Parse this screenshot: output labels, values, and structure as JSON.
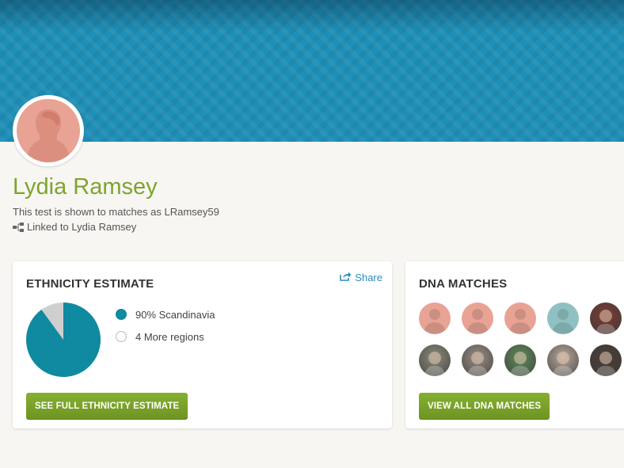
{
  "profile": {
    "name": "Lydia Ramsey",
    "shown_as": "This test is shown to matches as LRamsey59",
    "linked_to": "Linked to Lydia Ramsey"
  },
  "ethnicity": {
    "title": "ETHNICITY ESTIMATE",
    "share_label": "Share",
    "regions": [
      {
        "label": "90% Scandinavia"
      },
      {
        "label": "4 More regions"
      }
    ],
    "button_label": "SEE FULL ETHNICITY ESTIMATE",
    "primary_percent": 90,
    "colors": {
      "primary": "#0f8aa0",
      "other": "#cfcfcf"
    }
  },
  "dna_matches": {
    "title": "DNA MATCHES",
    "button_label": "VIEW ALL DNA MATCHES",
    "avatars": [
      {
        "type": "silhouette",
        "color": "#e8a394"
      },
      {
        "type": "silhouette",
        "color": "#e8a394"
      },
      {
        "type": "silhouette",
        "color": "#e8a394"
      },
      {
        "type": "silhouette",
        "color": "#8fc1c3"
      },
      {
        "type": "photo",
        "color": "#7a3b32"
      },
      {
        "type": "photo",
        "color": "#8a8a7a"
      },
      {
        "type": "photo",
        "color": "#9a8e82"
      },
      {
        "type": "photo",
        "color": "#5f8a58"
      },
      {
        "type": "photo",
        "color": "#b9a99b"
      },
      {
        "type": "photo",
        "color": "#4a3e36"
      }
    ]
  }
}
